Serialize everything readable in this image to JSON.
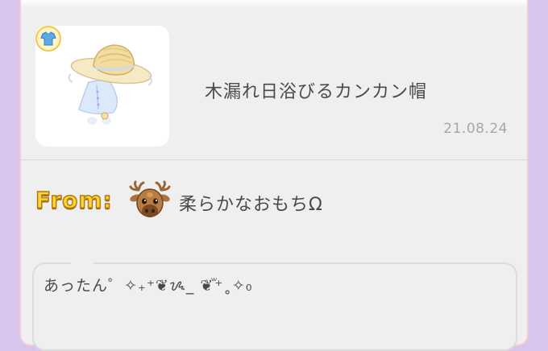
{
  "item": {
    "name": "木漏れ日浴びるカンカン帽",
    "date": "21.08.24",
    "thumbnail_icon": "straw-hat-outfit-icon",
    "category_icon": "outfit-category-icon"
  },
  "sender": {
    "from_label": "From:",
    "name": "柔らかなおもちΩ",
    "avatar_icon": "reindeer-avatar-icon"
  },
  "message": {
    "text": "あったん゜✧₊⁺❦ᝰ_ ❦ꙻ⁺˳✧₀"
  },
  "colors": {
    "background": "#d9c4ee",
    "card": "#efefef",
    "card_border": "#f2c9d9",
    "from_label": "#ffd43a"
  }
}
